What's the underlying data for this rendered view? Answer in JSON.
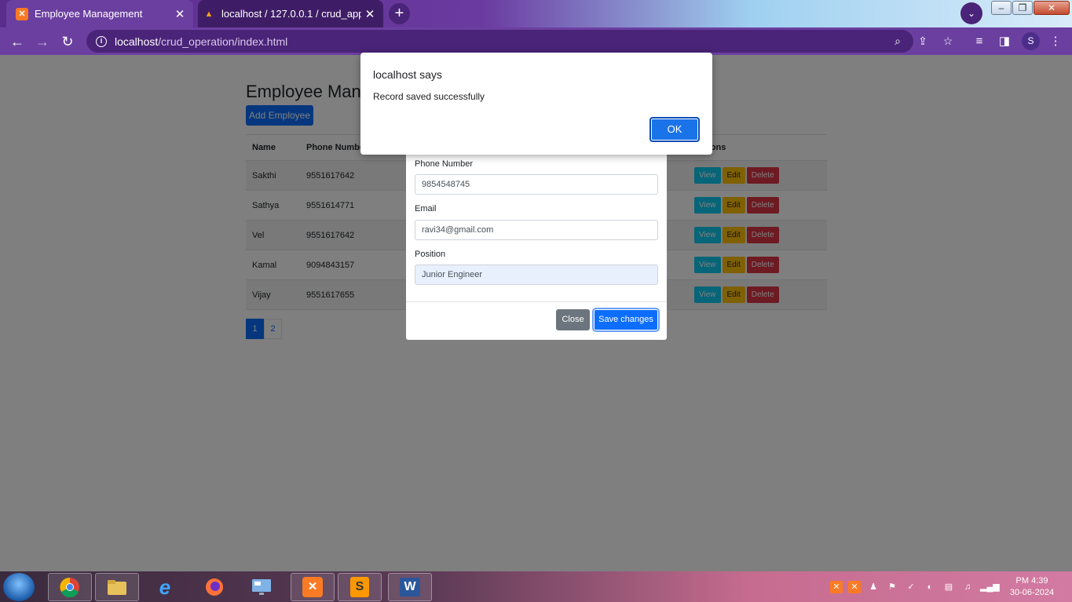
{
  "browser": {
    "tabs": [
      {
        "title": "Employee Management",
        "active": true
      },
      {
        "title": "localhost / 127.0.0.1 / crud_app /",
        "active": false
      }
    ],
    "new_tab": "+",
    "url_host": "localhost",
    "url_path": "/crud_operation/index.html",
    "profile_initial": "S"
  },
  "page": {
    "title": "Employee Management",
    "add_button": "Add Employee",
    "table": {
      "headers": [
        "Name",
        "Phone Number",
        "",
        "Actions"
      ],
      "rows": [
        {
          "name": "Sakthi",
          "phone": "9551617642"
        },
        {
          "name": "Sathya",
          "phone": "9551614771"
        },
        {
          "name": "Vel",
          "phone": "9551617642"
        },
        {
          "name": "Kamal",
          "phone": "9094843157"
        },
        {
          "name": "Vijay",
          "phone": "9551617655"
        }
      ],
      "actions": {
        "view": "View",
        "edit": "Edit",
        "delete": "Delete"
      }
    },
    "pagination": [
      "1",
      "2"
    ]
  },
  "modal": {
    "fields": [
      {
        "label": "Phone Number",
        "value": "9854548745"
      },
      {
        "label": "Email",
        "value": "ravi34@gmail.com"
      },
      {
        "label": "Position",
        "value": "Junior Engineer"
      }
    ],
    "close_label": "Close",
    "save_label": "Save changes"
  },
  "alert": {
    "title": "localhost says",
    "message": "Record saved successfully",
    "ok_label": "OK"
  },
  "taskbar": {
    "time": "PM 4:39",
    "date": "30-06-2024"
  },
  "colors": {
    "browser_frame": "#6b3fa0",
    "primary": "#0d6efd",
    "info": "#0dcaf0",
    "warning": "#ffc107",
    "danger": "#dc3545",
    "secondary": "#6c757d"
  }
}
